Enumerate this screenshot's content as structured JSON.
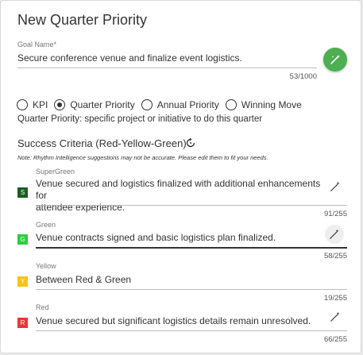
{
  "dialog": {
    "title": "New Quarter Priority"
  },
  "goal": {
    "label": "Goal Name*",
    "value": "Secure conference venue and finalize event logistics.",
    "counter": "53/1000"
  },
  "types": {
    "options": [
      {
        "label": "KPI",
        "checked": false
      },
      {
        "label": "Quarter Priority",
        "checked": true
      },
      {
        "label": "Annual Priority",
        "checked": false
      },
      {
        "label": "Winning Move",
        "checked": false
      }
    ],
    "description": "Quarter Priority: specific project or initiative to do this quarter"
  },
  "criteria": {
    "heading": "Success Criteria (Red-Yellow-Green)",
    "note": "Note: Rhythm Intelligence suggestions may not be accurate. Please edit them to fit your needs.",
    "items": [
      {
        "label": "SuperGreen",
        "badge": "S",
        "color": "#1b5e20",
        "line1": "Venue secured and logistics finalized with additional enhancements for",
        "line2": "attendee experience.",
        "counter": "91/255"
      },
      {
        "label": "Green",
        "badge": "G",
        "color": "#2ecc40",
        "line1": "Venue contracts signed and basic logistics plan finalized.",
        "line2": "",
        "counter": "58/255"
      },
      {
        "label": "Yellow",
        "badge": "Y",
        "color": "#f5c518",
        "line1": "Between Red & Green",
        "line2": "",
        "counter": "19/255"
      },
      {
        "label": "Red",
        "badge": "R",
        "color": "#e53935",
        "line1": "Venue secured but significant logistics details remain unresolved.",
        "line2": "",
        "counter": "66/255"
      }
    ]
  },
  "icons": {
    "magic": "magic-wand-icon",
    "refresh": "refresh-icon"
  }
}
